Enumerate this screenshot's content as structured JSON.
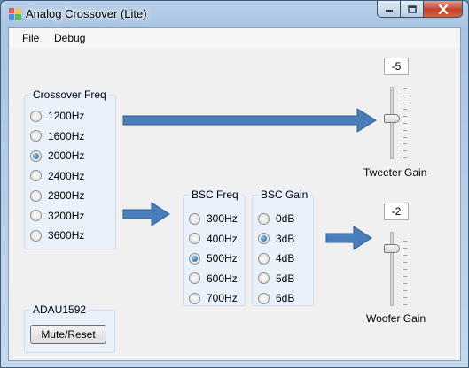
{
  "window": {
    "title": "Analog Crossover (Lite)"
  },
  "menu": {
    "file": "File",
    "debug": "Debug"
  },
  "crossover": {
    "title": "Crossover Freq",
    "options": [
      "1200Hz",
      "1600Hz",
      "2000Hz",
      "2400Hz",
      "2800Hz",
      "3200Hz",
      "3600Hz"
    ],
    "selected": "2000Hz"
  },
  "bsc_freq": {
    "title": "BSC Freq",
    "options": [
      "300Hz",
      "400Hz",
      "500Hz",
      "600Hz",
      "700Hz"
    ],
    "selected": "500Hz"
  },
  "bsc_gain": {
    "title": "BSC Gain",
    "options": [
      "0dB",
      "3dB",
      "4dB",
      "5dB",
      "6dB"
    ],
    "selected": "3dB"
  },
  "adau": {
    "title": "ADAU1592",
    "button": "Mute/Reset"
  },
  "tweeter": {
    "value": "-5",
    "label": "Tweeter Gain"
  },
  "woofer": {
    "value": "-2",
    "label": "Woofer Gain"
  },
  "colors": {
    "arrow": "#4a7ebb",
    "arrow_stroke": "#2c5d92",
    "window_frame": "#a9c4e2",
    "group_bg": "#e9f2fa"
  },
  "icons": {
    "app": "app-icon",
    "minimize": "minimize-icon",
    "maximize": "maximize-icon",
    "close": "close-icon"
  }
}
